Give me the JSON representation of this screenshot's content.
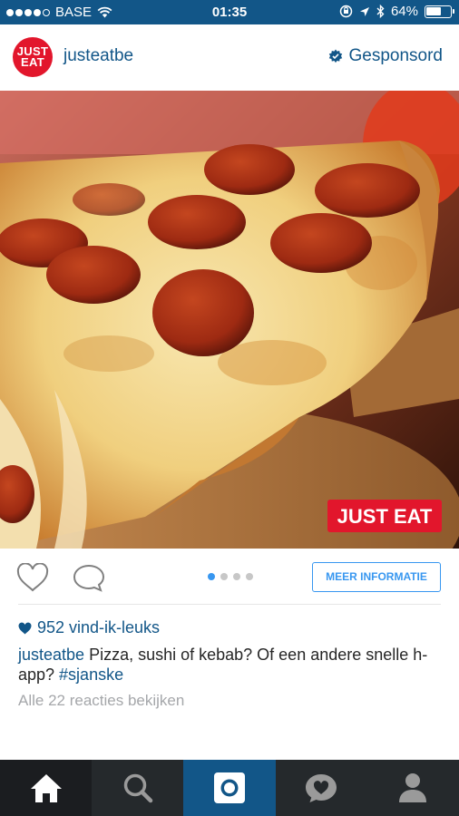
{
  "status_bar": {
    "carrier": "BASE",
    "time": "01:35",
    "battery_percent": "64%",
    "battery_level": 0.64,
    "signal_bars": 4
  },
  "post": {
    "avatar_text_1": "JUST",
    "avatar_text_2": "EAT",
    "username": "justeatbe",
    "sponsored_label": "Gesponsord",
    "photo": {
      "subject": "pepperoni pizza slice on wooden peel",
      "logo_text": "JUST EAT"
    },
    "pager": {
      "count": 4,
      "active_index": 0
    },
    "cta_label": "MEER INFORMATIE",
    "likes": "952 vind-ik-leuks",
    "caption": {
      "user": "justeatbe",
      "text": " Pizza, sushi of kebab? Of een andere snelle h-app? ",
      "hashtag": "#sjanske"
    },
    "view_comments": "Alle 22 reacties bekijken"
  },
  "tab_bar": {
    "items": [
      "home-icon",
      "search-icon",
      "camera-icon",
      "activity-icon",
      "profile-icon"
    ],
    "active": "home-icon"
  },
  "colors": {
    "brand_blue": "#125688",
    "link_blue": "#3897f0",
    "just_eat_red": "#e2162c",
    "tab_bar_bg": "#25292c"
  }
}
